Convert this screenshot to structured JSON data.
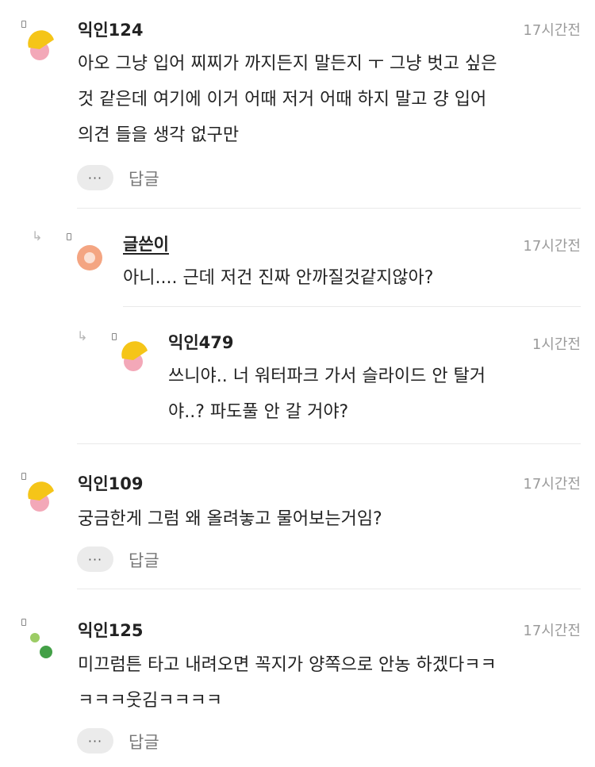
{
  "comments": [
    {
      "nickname": "익인124",
      "time": "17시간전",
      "text": "아오 그냥 입어 찌찌가 까지든지 말든지 ㅜ 그냥 벗고 싶은\n것 같은데 여기에 이거 어때 저거 어때 하지 말고 걍 입어\n의견 들을 생각 없구만",
      "more_label": "···",
      "reply_label": "답글",
      "avatar_icon": "yellow-pink-bubble-avatar",
      "replies": [
        {
          "nickname": "글쓴이",
          "time": "17시간전",
          "text": "아니.... 근데 저건 진짜 안까질것같지않아?",
          "avatar_icon": "orange-ring-avatar",
          "replies": [
            {
              "nickname": "익인479",
              "time": "1시간전",
              "text": "쓰니야.. 너 워터파크 가서 슬라이드 안 탈거\n야..? 파도풀 안 갈 거야?",
              "avatar_icon": "yellow-pink-bubble-avatar"
            }
          ]
        }
      ]
    },
    {
      "nickname": "익인109",
      "time": "17시간전",
      "text": "궁금한게 그럼 왜 올려놓고 물어보는거임?",
      "more_label": "···",
      "reply_label": "답글",
      "avatar_icon": "yellow-pink-bubble-avatar"
    },
    {
      "nickname": "익인125",
      "time": "17시간전",
      "text": "미끄럼튼 타고 내려오면 꼭지가 양쪽으로 안농 하겠다ㅋㅋ\nㅋㅋㅋ웃김ㅋㅋㅋㅋ",
      "more_label": "···",
      "reply_label": "답글",
      "avatar_icon": "green-dots-avatar"
    }
  ],
  "colors": {
    "text": "#222222",
    "muted": "#9b9b9b",
    "divider": "#e9e9e9",
    "button_bg": "#ebebeb",
    "avatar_yellow": "#f5c518",
    "avatar_pink": "#f3a8b8",
    "avatar_orange": "#f4a582",
    "avatar_green_light": "#9ccc65",
    "avatar_green_dark": "#43a047"
  }
}
